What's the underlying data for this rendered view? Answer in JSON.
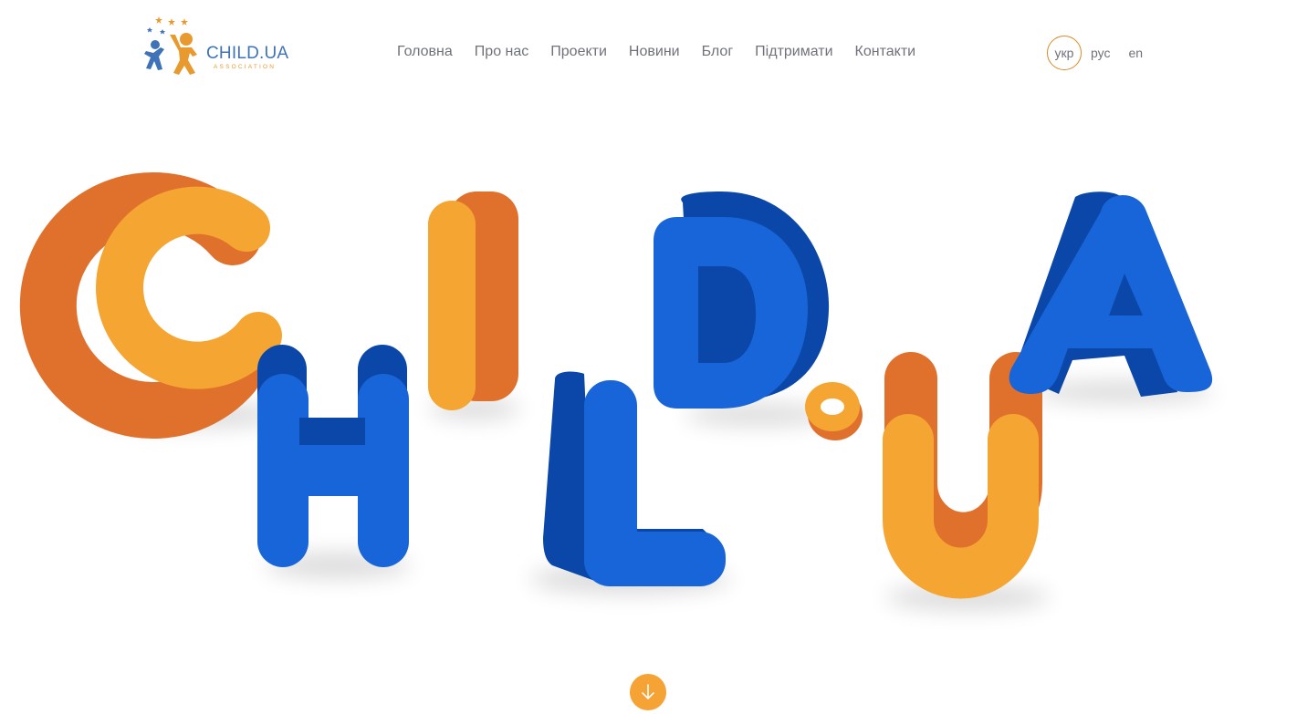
{
  "brand": {
    "name": "CHILD.UA",
    "subtitle": "ASSOCIATION"
  },
  "nav": {
    "items": [
      "Головна",
      "Про нас",
      "Проекти",
      "Новини",
      "Блог",
      "Підтримати",
      "Контакти"
    ]
  },
  "languages": {
    "active": "укр",
    "ru": "рус",
    "en": "en"
  },
  "hero": {
    "letters": [
      "C",
      "H",
      "I",
      "L",
      "D",
      ".",
      "U",
      "A"
    ]
  },
  "colors": {
    "blue": "#1765d8",
    "blue_dark": "#0a47a9",
    "orange": "#f4a532",
    "orange_dark": "#e0712c",
    "logo_blue": "#3f73b8"
  },
  "icons": {
    "scroll": "arrow-down-icon"
  }
}
